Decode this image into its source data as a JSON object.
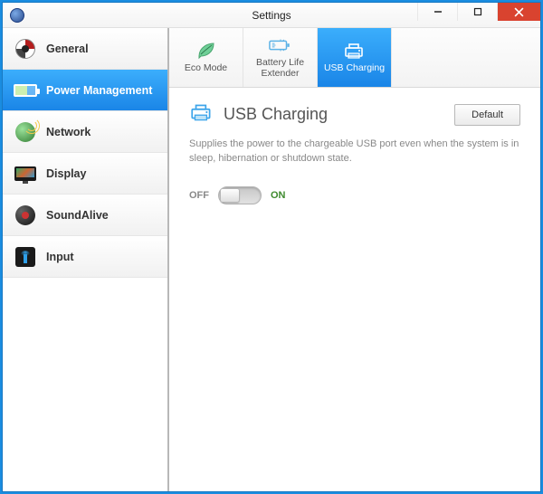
{
  "window": {
    "title": "Settings"
  },
  "sidebar": {
    "items": [
      {
        "label": "General"
      },
      {
        "label": "Power Management"
      },
      {
        "label": "Network"
      },
      {
        "label": "Display"
      },
      {
        "label": "SoundAlive"
      },
      {
        "label": "Input"
      }
    ],
    "active_index": 1
  },
  "tabs": {
    "items": [
      {
        "label": "Eco Mode"
      },
      {
        "label": "Battery Life Extender"
      },
      {
        "label": "USB Charging"
      }
    ],
    "active_index": 2
  },
  "panel": {
    "title": "USB Charging",
    "default_button": "Default",
    "description": "Supplies the power to the chargeable USB port even when the system is in sleep, hibernation or shutdown state.",
    "toggle": {
      "off_label": "OFF",
      "on_label": "ON",
      "state": "off"
    }
  }
}
